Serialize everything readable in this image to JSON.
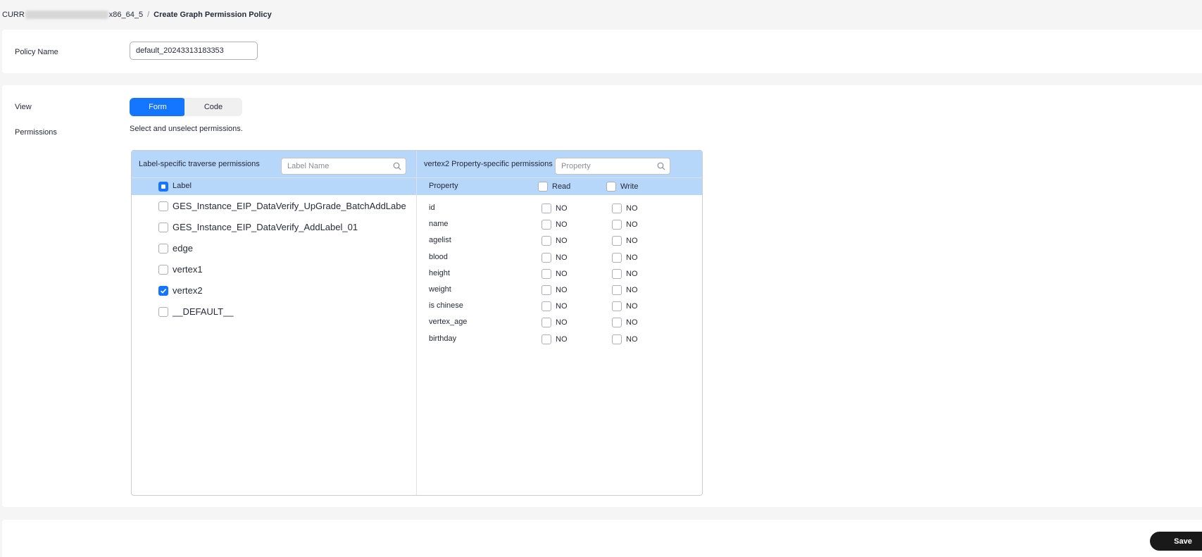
{
  "breadcrumb": {
    "prefix": "CURR",
    "suffix": "x86_64_5",
    "separator": "/",
    "current": "Create Graph Permission Policy"
  },
  "policy": {
    "label": "Policy Name",
    "value": "default_20243313183353"
  },
  "view": {
    "label": "View",
    "options": [
      "Form",
      "Code"
    ],
    "active": "Form"
  },
  "permissions": {
    "label": "Permissions",
    "hint": "Select and unselect permissions."
  },
  "left_pane": {
    "title": "Label-specific traverse permissions",
    "search_placeholder": "Label Name",
    "header_label": "Label",
    "header_state": "indeterminate",
    "labels": [
      {
        "name": "GES_Instance_EIP_DataVerify_UpGrade_BatchAddLabe",
        "checked": false
      },
      {
        "name": "GES_Instance_EIP_DataVerify_AddLabel_01",
        "checked": false
      },
      {
        "name": "edge",
        "checked": false
      },
      {
        "name": "vertex1",
        "checked": false
      },
      {
        "name": "vertex2",
        "checked": true
      },
      {
        "name": "__DEFAULT__",
        "checked": false
      }
    ]
  },
  "right_pane": {
    "title": "vertex2 Property-specific permissions",
    "search_placeholder": "Property",
    "col_property": "Property",
    "col_read": "Read",
    "col_write": "Write",
    "properties": [
      {
        "name": "id",
        "read": "NO",
        "write": "NO"
      },
      {
        "name": "name",
        "read": "NO",
        "write": "NO"
      },
      {
        "name": "agelist",
        "read": "NO",
        "write": "NO"
      },
      {
        "name": "blood",
        "read": "NO",
        "write": "NO"
      },
      {
        "name": "height",
        "read": "NO",
        "write": "NO"
      },
      {
        "name": "weight",
        "read": "NO",
        "write": "NO"
      },
      {
        "name": "is chinese",
        "read": "NO",
        "write": "NO"
      },
      {
        "name": "vertex_age",
        "read": "NO",
        "write": "NO"
      },
      {
        "name": "birthday",
        "read": "NO",
        "write": "NO"
      }
    ]
  },
  "footer": {
    "save_label": "Save"
  },
  "colors": {
    "primary": "#1476ff",
    "table_header": "#b6d6fa",
    "save_button": "#191919"
  }
}
